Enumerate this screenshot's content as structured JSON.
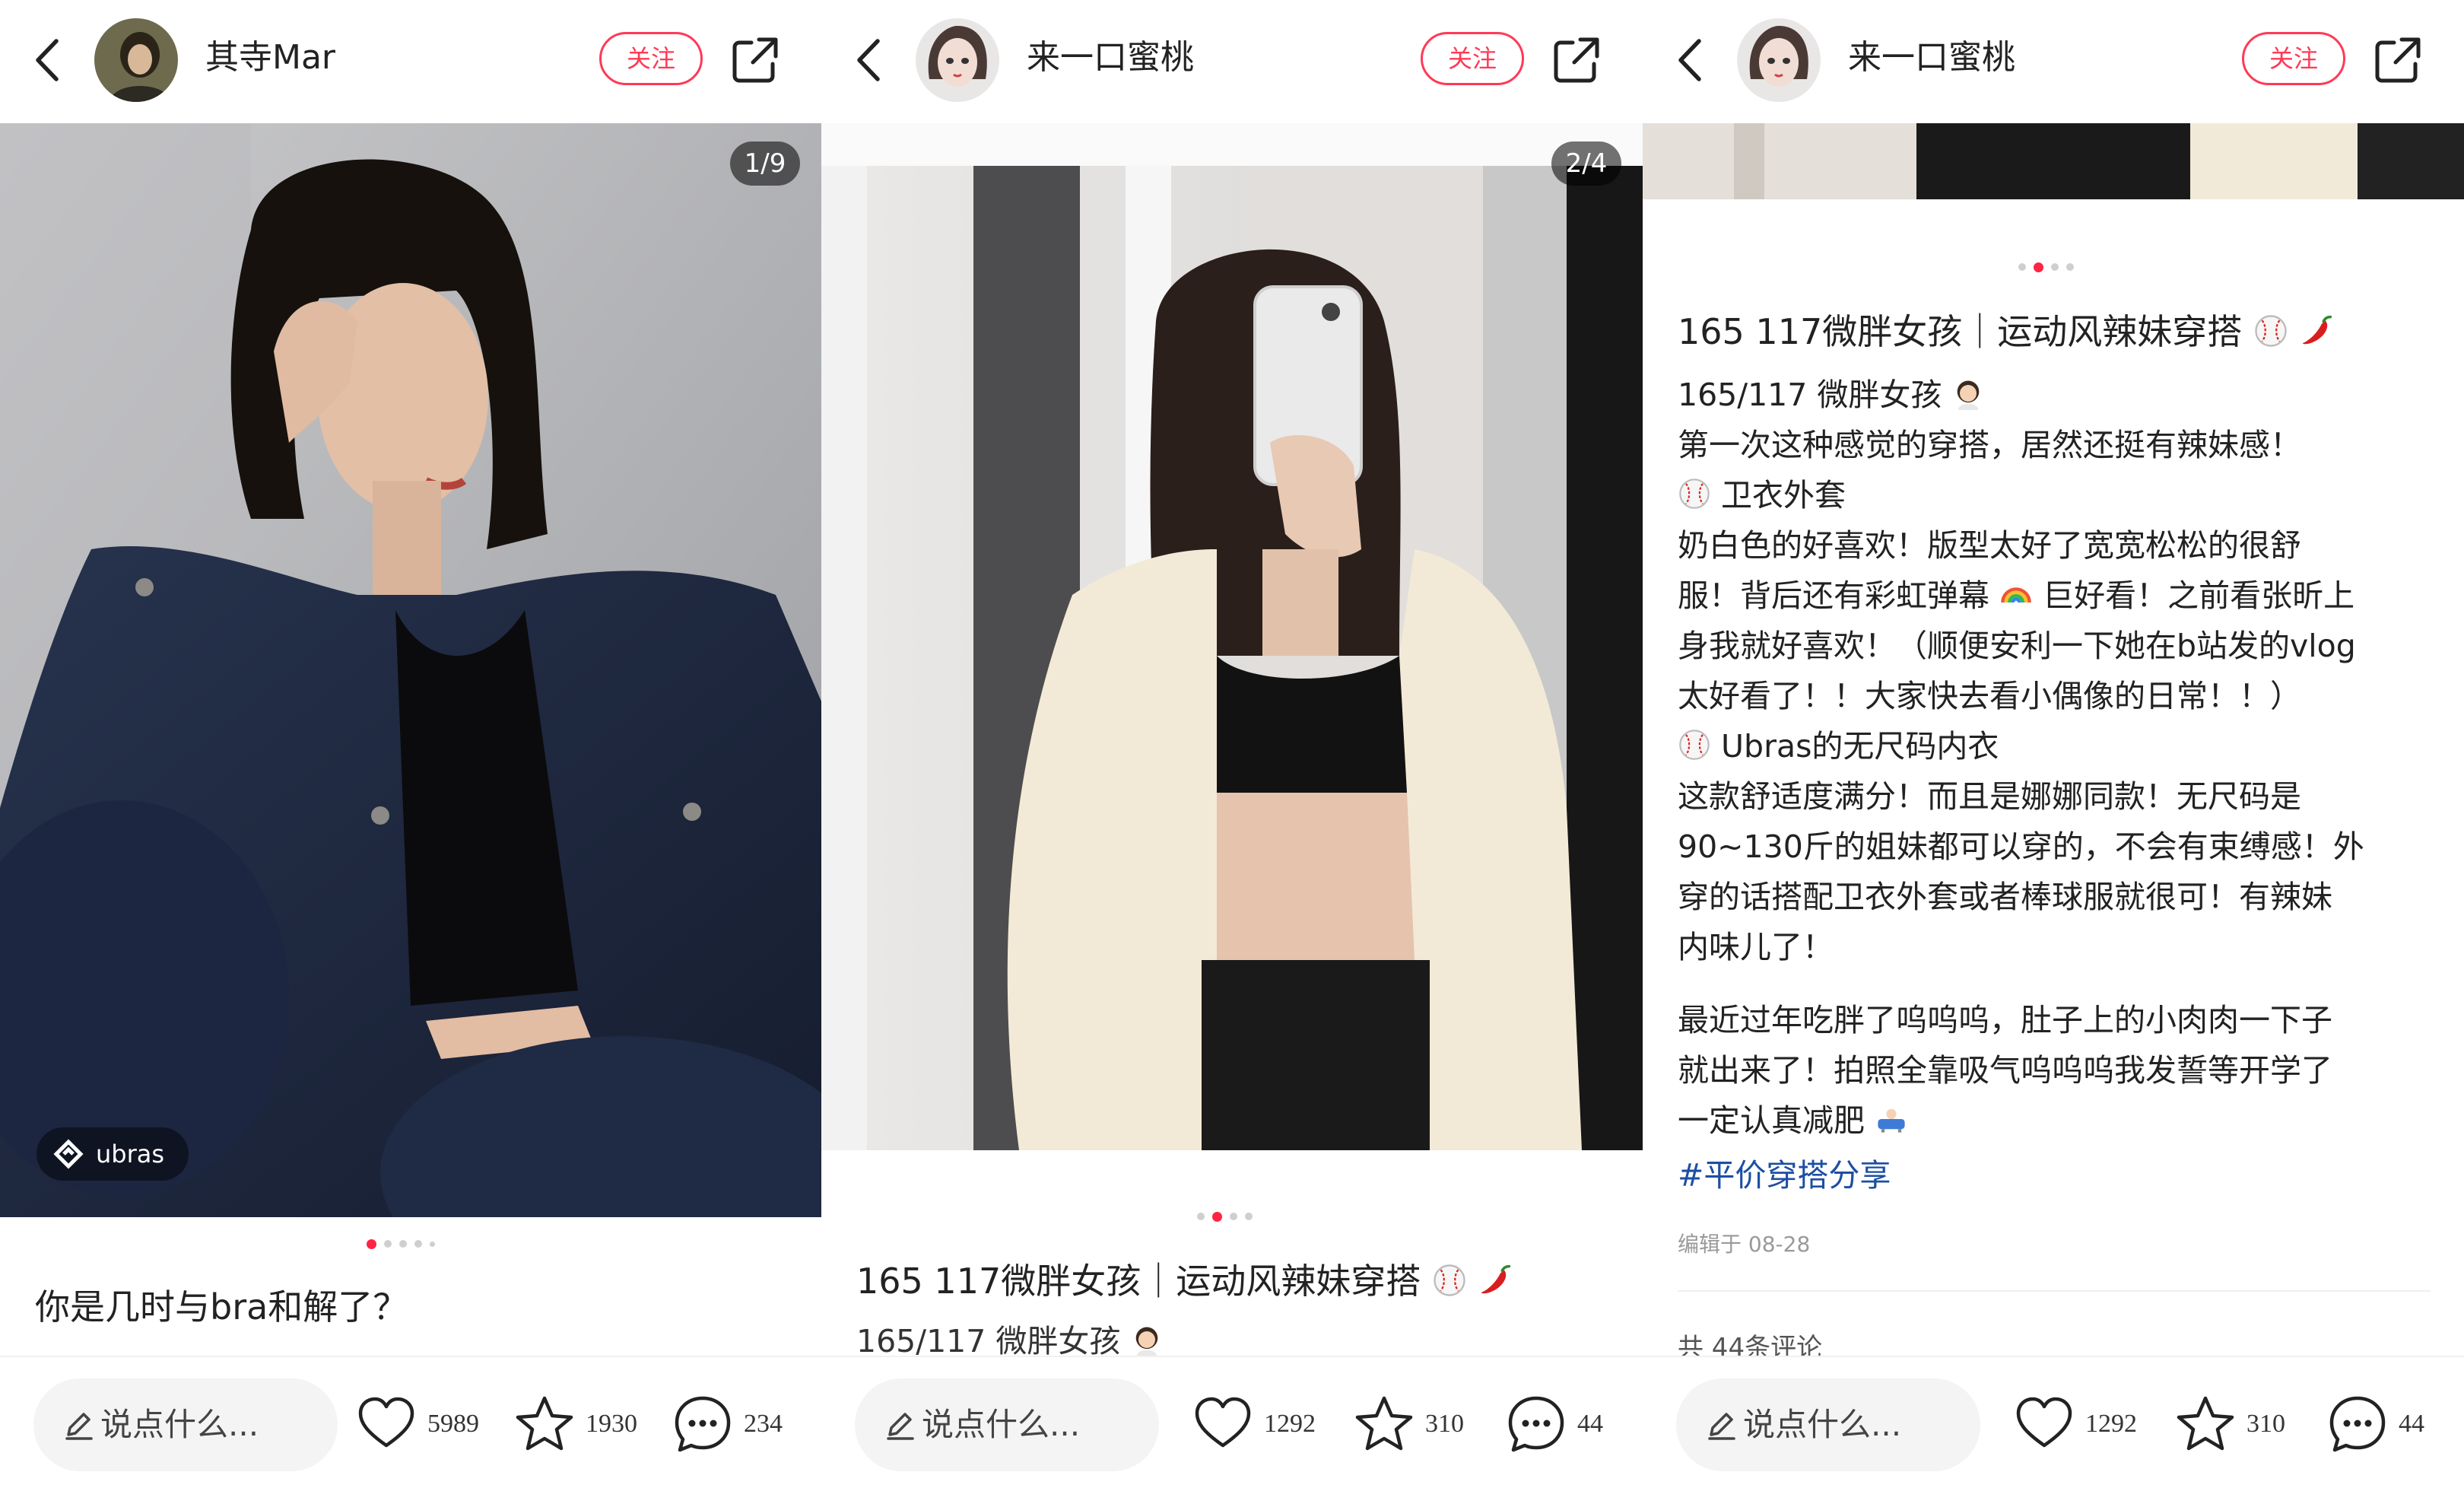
{
  "panels": [
    {
      "author": "其寺Mar",
      "follow_label": "关注",
      "image_counter": "1/9",
      "brand_tag": "ubras",
      "title": "你是几时与bra和解了？",
      "comment_placeholder": "说点什么...",
      "likes": "5989",
      "collects": "1930",
      "comments": "234",
      "dots_total": 5,
      "dots_active": 0
    },
    {
      "author": "来一口蜜桃",
      "follow_label": "关注",
      "image_counter": "2/4",
      "title": "165 117微胖女孩｜运动风辣妹穿搭",
      "preview_line": "165/117 微胖女孩",
      "comment_placeholder": "说点什么...",
      "likes": "1292",
      "collects": "310",
      "comments": "44",
      "dots_total": 4,
      "dots_active": 1
    },
    {
      "author": "来一口蜜桃",
      "follow_label": "关注",
      "title": "165 117微胖女孩｜运动风辣妹穿搭",
      "body_lines": [
        "165/117 微胖女孩",
        "第一次这种感觉的穿搭，居然还挺有辣妹感！",
        "卫衣外套",
        "奶白色的好喜欢！版型太好了宽宽松松的很舒",
        "服！背后还有彩虹弹幕",
        "巨好看！之前看张昕上",
        "身我就好喜欢！（顺便安利一下她在b站发的vlog",
        "太好看了！！大家快去看小偶像的日常！！）",
        "Ubras的无尺码内衣",
        "这款舒适度满分！而且是娜娜同款！无尺码是",
        "90~130斤的姐妹都可以穿的，不会有束缚感！外",
        "穿的话搭配卫衣外套或者棒球服就很可！有辣妹",
        "内味儿了！",
        "最近过年吃胖了呜呜呜，肚子上的小肉肉一下子",
        "就出来了！拍照全靠吸气呜呜呜我发誓等开学了",
        "一定认真减肥"
      ],
      "hashtag": "#平价穿搭分享",
      "edit_date": "编辑于 08-28",
      "comments_partial": "共 44条评论",
      "comment_placeholder": "说点什么...",
      "likes": "1292",
      "collects": "310",
      "comments": "44",
      "dots_total": 4,
      "dots_active": 1
    }
  ],
  "colors": {
    "accent": "#ff2442",
    "hashtag": "#1d4ea3",
    "background": "#ffffff"
  },
  "icons": [
    "back-arrow-icon",
    "share-icon",
    "heart-icon",
    "star-icon",
    "comment-bubble-icon",
    "pencil-icon",
    "baseball-emoji",
    "chili-emoji",
    "girl-emoji",
    "rainbow-emoji",
    "bath-emoji"
  ]
}
